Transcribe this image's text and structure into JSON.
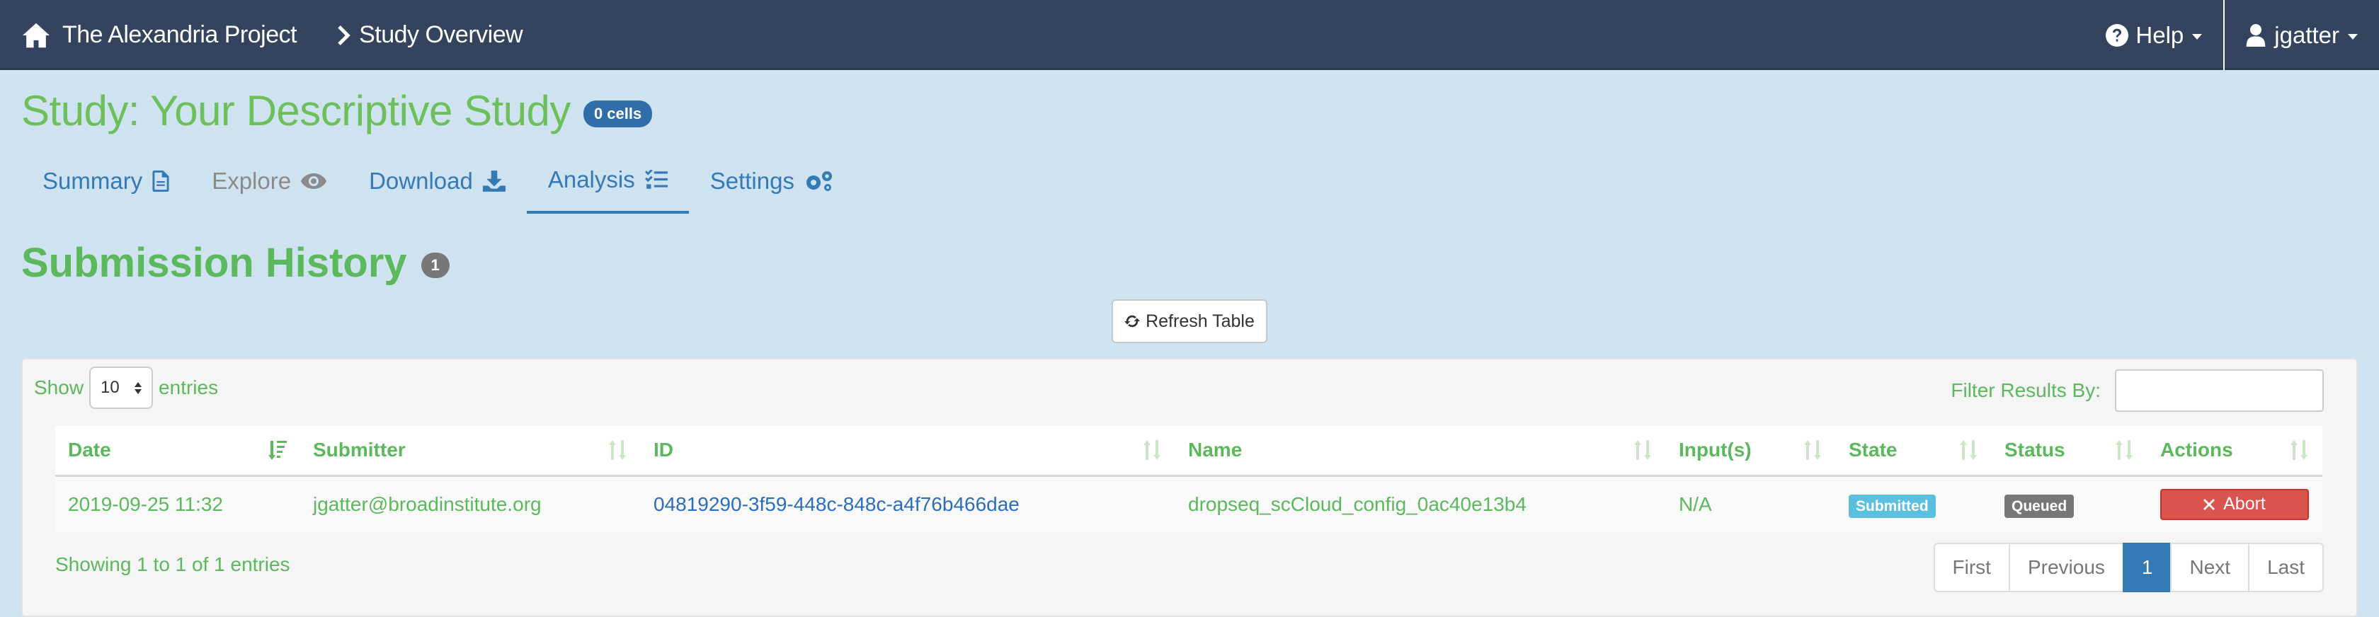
{
  "navbar": {
    "brand": "The Alexandria Project",
    "breadcrumb": "Study Overview",
    "help_label": "Help",
    "user_label": "jgatter"
  },
  "study": {
    "title": "Study: Your Descriptive Study",
    "cells_badge": "0 cells"
  },
  "tabs": [
    {
      "label": "Summary",
      "icon": "file-icon",
      "state": "normal"
    },
    {
      "label": "Explore",
      "icon": "eye-icon",
      "state": "disabled"
    },
    {
      "label": "Download",
      "icon": "download-icon",
      "state": "normal"
    },
    {
      "label": "Analysis",
      "icon": "tasks-icon",
      "state": "active"
    },
    {
      "label": "Settings",
      "icon": "gears-icon",
      "state": "normal"
    }
  ],
  "history": {
    "title": "Submission History",
    "count": "1",
    "refresh_label": "Refresh Table"
  },
  "table_controls": {
    "show_label": "Show",
    "entries_label": "entries",
    "page_length": "10",
    "filter_label": "Filter Results By:",
    "filter_value": ""
  },
  "table": {
    "headers": [
      "Date",
      "Submitter",
      "ID",
      "Name",
      "Input(s)",
      "State",
      "Status",
      "Actions"
    ],
    "rows": [
      {
        "date": "2019-09-25 11:32",
        "submitter": "jgatter@broadinstitute.org",
        "id": "04819290-3f59-448c-848c-a4f76b466dae",
        "name": "dropseq_scCloud_config_0ac40e13b4",
        "inputs": "N/A",
        "state": "Submitted",
        "status": "Queued",
        "action": "Abort"
      }
    ]
  },
  "footer": {
    "info": "Showing 1 to 1 of 1 entries",
    "pager": [
      "First",
      "Previous",
      "1",
      "Next",
      "Last"
    ],
    "current_page": "1"
  },
  "colors": {
    "navbar": "#34445e",
    "background": "#cfe2f0",
    "accent_green": "#5cb85c",
    "link_blue": "#337ab7",
    "danger": "#d9534f",
    "info_label": "#5bc0de"
  }
}
